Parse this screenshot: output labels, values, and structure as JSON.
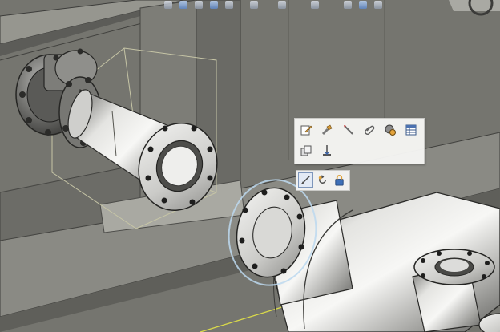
{
  "colors": {
    "background": "#6f6f69",
    "steel_light": "#e8e8e6",
    "steel_dark": "#4e4e4c",
    "selection_highlight": "#bcd8ee",
    "guide_line": "#d9d94a",
    "toolbar_bg": "#f6f6f4"
  },
  "top_toolbar": {
    "icons": [
      "display-style-icon",
      "view-cube-icon",
      "layers-icon",
      "shade-icon",
      "section-icon",
      "light-icon",
      "orbit-icon",
      "zoom-icon",
      "walk-icon",
      "tag-icon",
      "info-icon"
    ]
  },
  "context_toolbar": {
    "row1": [
      "edit-properties-icon",
      "modify-pipe-icon",
      "insert-tool-icon",
      "attach-icon",
      "object-settings-icon",
      "data-table-icon"
    ],
    "row2": [
      "copy-icon",
      "anchor-icon"
    ]
  },
  "mini_toolbar": {
    "items": [
      "draw-route-icon",
      "rotate-icon",
      "lock-icon"
    ],
    "active": "draw-route-icon"
  }
}
